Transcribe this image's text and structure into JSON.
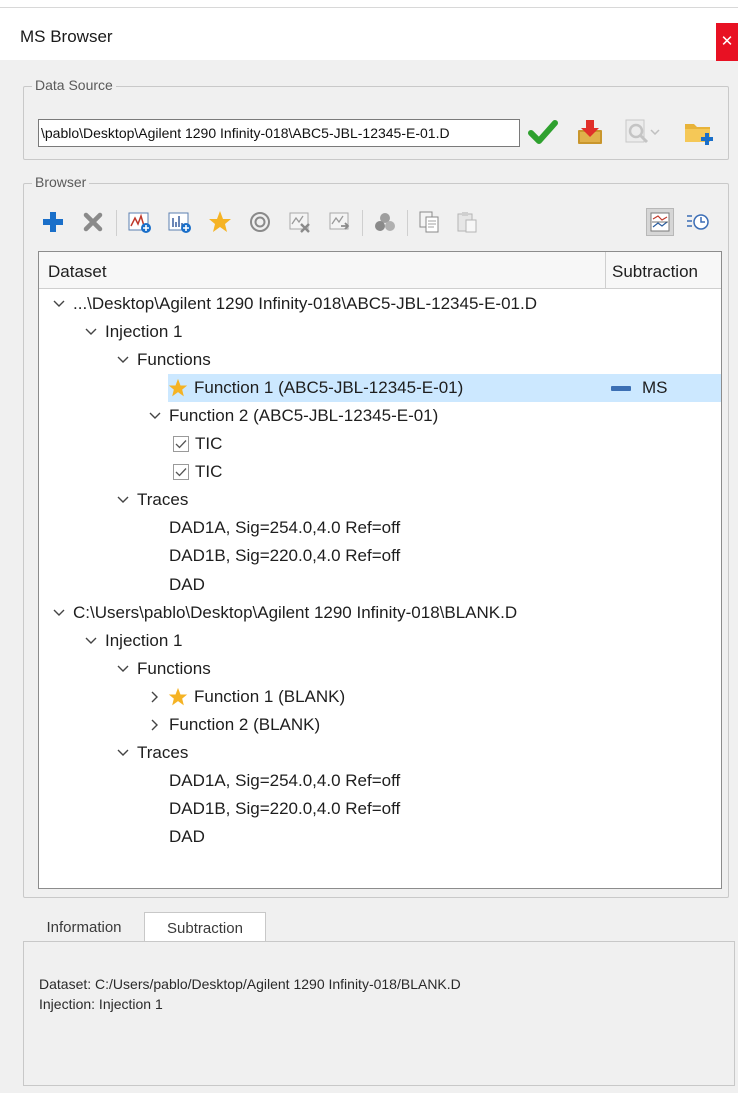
{
  "window": {
    "title": "MS Browser",
    "close_glyph": "✕"
  },
  "data_source": {
    "label": "Data Source",
    "path_value": "\\pablo\\Desktop\\Agilent 1290 Infinity-018\\ABC5-JBL-12345-E-01.D",
    "icons": [
      "checkmark-icon",
      "import-icon",
      "search-preview-icon",
      "dropdown-arrow-icon",
      "add-folder-icon"
    ]
  },
  "browser": {
    "label": "Browser",
    "toolbar_icons": [
      "add-icon",
      "remove-icon",
      "add-chromatogram-icon",
      "add-spectrum-icon",
      "star-icon",
      "target-icon",
      "remove-chart-icon",
      "chart-export-icon",
      "group-icon",
      "copy-icon",
      "paste-icon",
      "subtraction-view-icon",
      "time-sort-icon"
    ],
    "columns": {
      "dataset": "Dataset",
      "subtraction": "Subtraction"
    },
    "tree": [
      {
        "level": 0,
        "toggle": "expanded",
        "text": "...\\Desktop\\Agilent 1290 Infinity-018\\ABC5-JBL-12345-E-01.D"
      },
      {
        "level": 1,
        "toggle": "expanded",
        "text": "Injection 1"
      },
      {
        "level": 2,
        "toggle": "expanded",
        "text": "Functions"
      },
      {
        "level": 3,
        "toggle": "none",
        "star": true,
        "selected": true,
        "text": "Function 1 (ABC5-JBL-12345-E-01)",
        "subtraction": "MS"
      },
      {
        "level": 3,
        "toggle": "expanded",
        "text": "Function 2 (ABC5-JBL-12345-E-01)"
      },
      {
        "level": 4,
        "toggle": "none",
        "checkbox": true,
        "text": "TIC"
      },
      {
        "level": 4,
        "toggle": "none",
        "checkbox": true,
        "text": "TIC"
      },
      {
        "level": 2,
        "toggle": "expanded",
        "text": "Traces"
      },
      {
        "level": 3,
        "toggle": "none",
        "text": "DAD1A, Sig=254.0,4.0  Ref=off"
      },
      {
        "level": 3,
        "toggle": "none",
        "text": "DAD1B, Sig=220.0,4.0  Ref=off"
      },
      {
        "level": 3,
        "toggle": "none",
        "text": "DAD"
      },
      {
        "level": 0,
        "toggle": "expanded",
        "text": "C:\\Users\\pablo\\Desktop\\Agilent 1290 Infinity-018\\BLANK.D"
      },
      {
        "level": 1,
        "toggle": "expanded",
        "text": "Injection 1"
      },
      {
        "level": 2,
        "toggle": "expanded",
        "text": "Functions"
      },
      {
        "level": 3,
        "toggle": "collapsed",
        "star": true,
        "text": "Function 1 (BLANK)"
      },
      {
        "level": 3,
        "toggle": "collapsed",
        "text": "Function 2 (BLANK)"
      },
      {
        "level": 2,
        "toggle": "expanded",
        "text": "Traces"
      },
      {
        "level": 3,
        "toggle": "none",
        "text": "DAD1A, Sig=254.0,4.0  Ref=off"
      },
      {
        "level": 3,
        "toggle": "none",
        "text": "DAD1B, Sig=220.0,4.0  Ref=off"
      },
      {
        "level": 3,
        "toggle": "none",
        "text": "DAD"
      }
    ]
  },
  "tabs": [
    {
      "label": "Information",
      "active": false
    },
    {
      "label": "Subtraction",
      "active": true
    }
  ],
  "info": {
    "dataset_line": "Dataset: C:/Users/pablo/Desktop/Agilent 1290 Infinity-018/BLANK.D",
    "injection_line": "Injection: Injection 1"
  },
  "colors": {
    "selection": "#cce8ff",
    "star": "#f5b324",
    "accent_blue": "#1a6fc9",
    "check_green": "#2fa12f",
    "close_red": "#e81123"
  }
}
